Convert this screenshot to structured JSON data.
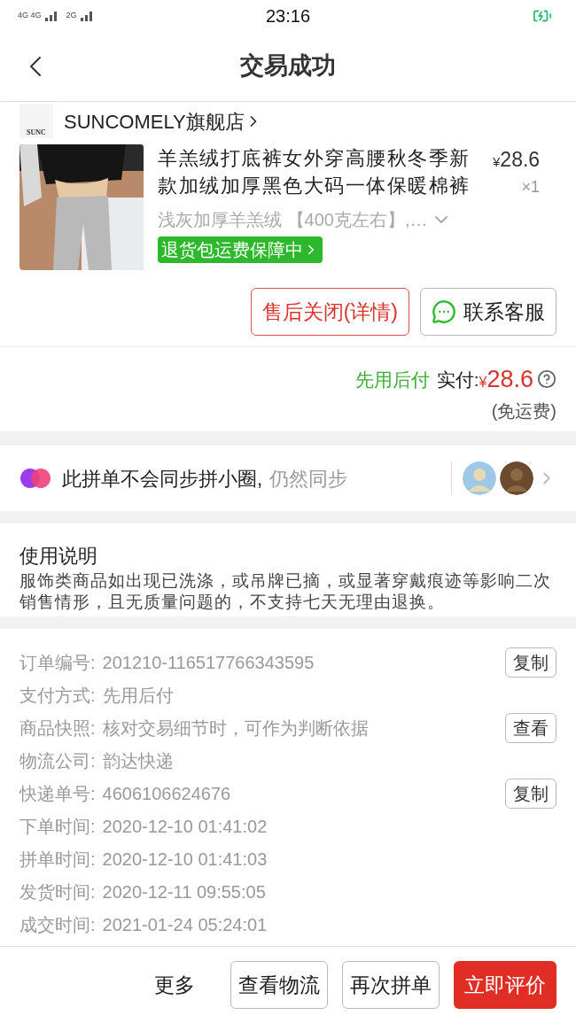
{
  "status_bar": {
    "network_1": "4G 4G",
    "network_2": "2G",
    "time": "23:16"
  },
  "header": {
    "title": "交易成功"
  },
  "store": {
    "name": "SUNCOMELY旗舰店",
    "logo_text": "SUNC"
  },
  "product": {
    "title": "羊羔绒打底裤女外穿高腰秋冬季新款加绒加厚黑色大码一体保暖棉裤",
    "price_symbol": "¥",
    "price": "28.6",
    "quantity": "×1",
    "spec": "浅灰加厚羊羔绒 【400克左右】,…",
    "badge": "退货包运费保障中"
  },
  "actions": [
    {
      "label": "售后关闭(详情)",
      "kind": "outline-red"
    },
    {
      "label": "联系客服",
      "kind": "chat"
    }
  ],
  "payment": {
    "method": "先用后付",
    "label": "实付:",
    "symbol": "¥",
    "amount": "28.6",
    "note": "(免运费)"
  },
  "pin_circle": {
    "text": "此拼单不会同步拼小圈,",
    "link": "仍然同步"
  },
  "usage": {
    "title": "使用说明",
    "body": "服饰类商品如出现已洗涤，或吊牌已摘，或显著穿戴痕迹等影响二次销售情形，且无质量问题的，不支持七天无理由退换。"
  },
  "order_info": [
    {
      "label": "订单编号:",
      "value": "201210-116517766343595",
      "button": "复制"
    },
    {
      "label": "支付方式:",
      "value": "先用后付"
    },
    {
      "label": "商品快照:",
      "value": "核对交易细节时，可作为判断依据",
      "button": "查看"
    },
    {
      "label": "物流公司:",
      "value": "韵达快递"
    },
    {
      "label": "快递单号:",
      "value": "4606106624676",
      "button": "复制"
    },
    {
      "label": "下单时间:",
      "value": "2020-12-10 01:41:02"
    },
    {
      "label": "拼单时间:",
      "value": "2020-12-10 01:41:03"
    },
    {
      "label": "发货时间:",
      "value": "2020-12-11 09:55:05"
    },
    {
      "label": "成交时间:",
      "value": "2021-01-24 05:24:01"
    }
  ],
  "bottom_bar": [
    {
      "label": "更多",
      "kind": "plain"
    },
    {
      "label": "查看物流",
      "kind": "outline"
    },
    {
      "label": "再次拼单",
      "kind": "outline"
    },
    {
      "label": "立即评价",
      "kind": "primary"
    }
  ]
}
